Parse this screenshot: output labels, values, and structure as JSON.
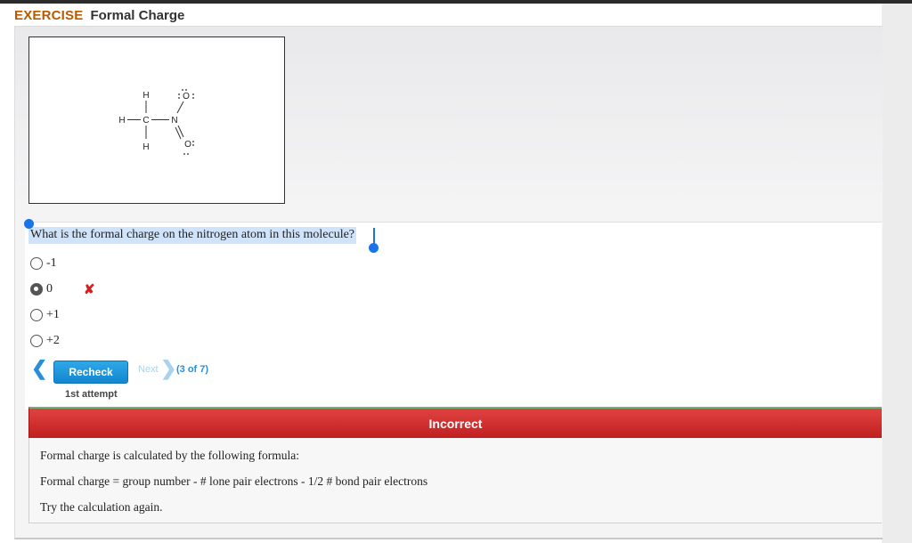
{
  "header": {
    "exercise": "EXERCISE",
    "title": "Formal Charge"
  },
  "molecule": {
    "atoms": {
      "h_top": "H",
      "h_left": "H",
      "c": "C",
      "h_bottom": "H",
      "n": "N",
      "o_top": "O",
      "o_bottom": "O"
    }
  },
  "question": "What is the formal charge on the nitrogen atom in this molecule?",
  "options": [
    {
      "label": "-1",
      "selected": false
    },
    {
      "label": "0",
      "selected": true
    },
    {
      "label": "+1",
      "selected": false
    },
    {
      "label": "+2",
      "selected": false
    }
  ],
  "wrong_mark": "✘",
  "nav": {
    "prev_icon": "chevron-left-icon",
    "prev_glyph": "❮",
    "recheck": "Recheck",
    "next": "Next",
    "next_glyph": "❯",
    "counter": "(3 of 7)",
    "attempt": "1st attempt"
  },
  "feedback": {
    "status": "Incorrect",
    "lines": [
      "Formal charge is calculated by the following formula:",
      "Formal charge = group number - # lone pair electrons - 1/2 # bond pair electrons",
      "Try the calculation again."
    ]
  },
  "colors": {
    "accent": "#1286cf",
    "error": "#c01f1f",
    "exercise": "#b85a00"
  }
}
